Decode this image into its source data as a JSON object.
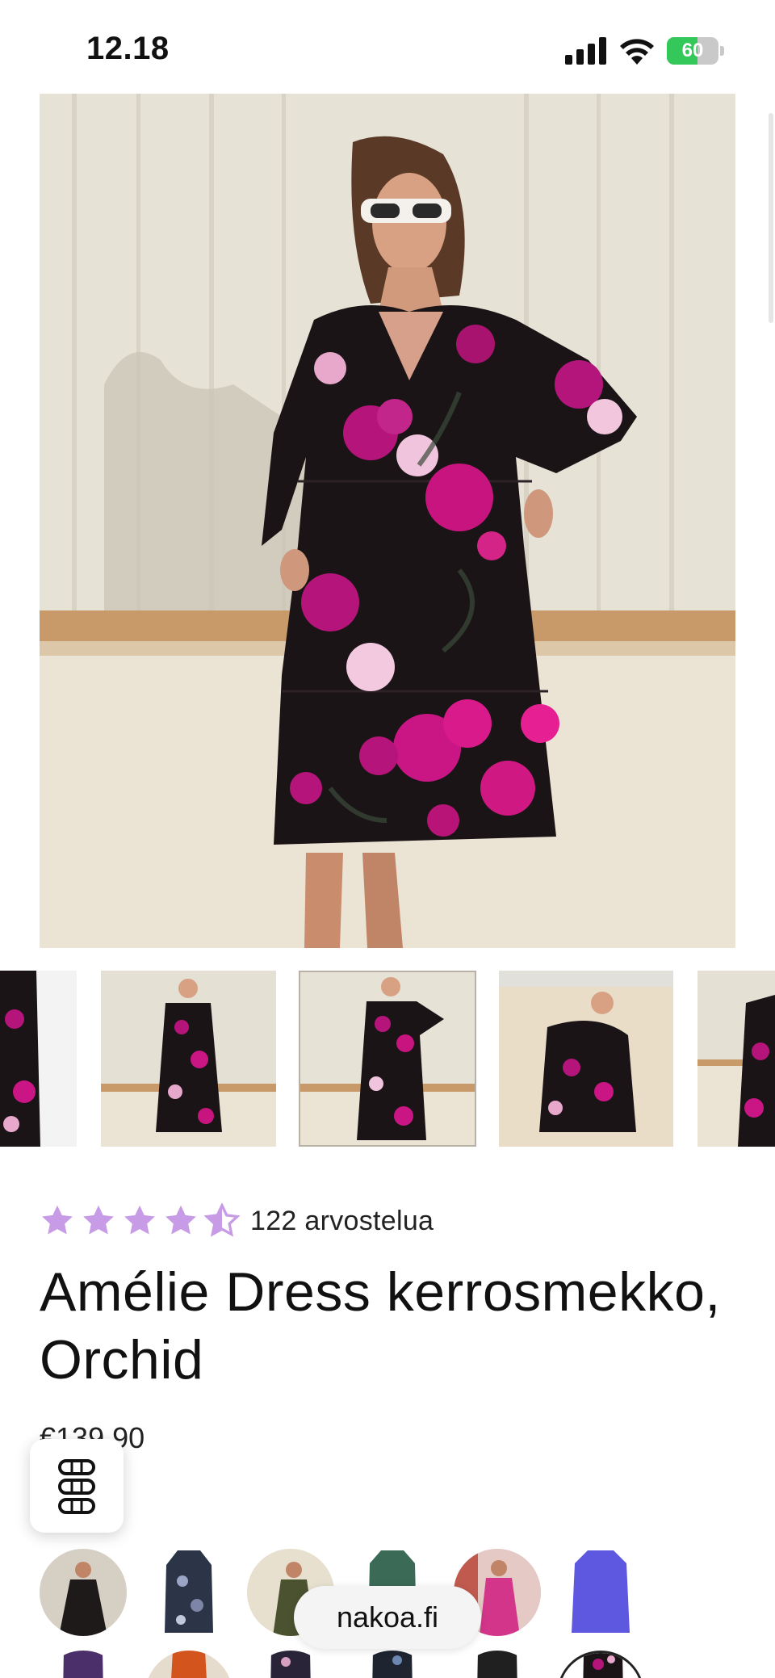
{
  "status_bar": {
    "time": "12.18",
    "battery_level": "60",
    "battery_fraction": 0.6,
    "icons": [
      "cellular-signal-icon",
      "wifi-icon",
      "battery-charging-icon"
    ]
  },
  "product": {
    "rating_value": 4.5,
    "rating_max": 5,
    "review_count_label": "122 arvostelua",
    "title": "Amélie Dress kerrosmekko, Orchid",
    "price": "€139,90"
  },
  "gallery": {
    "thumbnail_count": 5,
    "selected_thumbnail": 2
  },
  "colors": {
    "star": "#c79be6",
    "dress_base": "#1b1416",
    "orchid_magenta": "#b5147a",
    "orchid_pink": "#e89ac8",
    "battery_green": "#34c759"
  },
  "browser": {
    "url": "nakoa.fi"
  }
}
